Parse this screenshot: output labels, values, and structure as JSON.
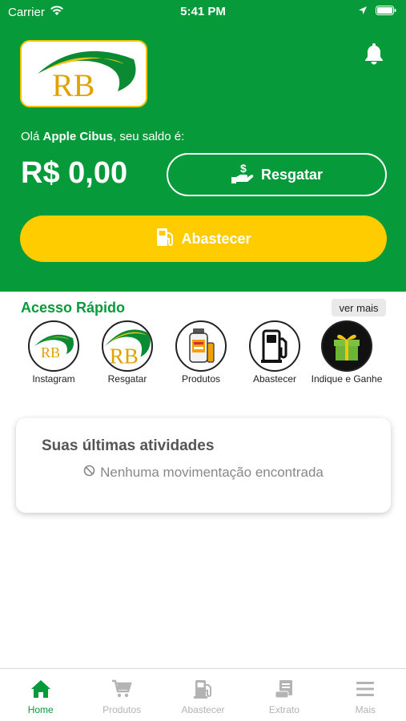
{
  "status_bar": {
    "carrier": "Carrier",
    "time": "5:41 PM"
  },
  "header": {
    "logo_text": "RB",
    "greeting_prefix": "Olá ",
    "user_name": "Apple Cibus",
    "greeting_suffix": ", seu saldo é:",
    "balance": "R$ 0,00",
    "resgatar_label": "Resgatar",
    "abastecer_label": "Abastecer"
  },
  "quick_access": {
    "title": "Acesso Rápido",
    "ver_mais": "ver mais",
    "items": [
      {
        "label": "Instagram",
        "icon": "rb-logo-icon"
      },
      {
        "label": "Resgatar",
        "icon": "rb-logo-icon"
      },
      {
        "label": "Produtos",
        "icon": "oil-bottle-icon"
      },
      {
        "label": "Abastecer",
        "icon": "fuel-pump-icon"
      },
      {
        "label": "Indique e Ganhe",
        "icon": "gift-icon"
      }
    ]
  },
  "activities": {
    "title": "Suas últimas atividades",
    "empty": "Nenhuma movimentação encontrada"
  },
  "tabbar": {
    "tabs": [
      {
        "label": "Home",
        "icon": "home-icon",
        "active": true
      },
      {
        "label": "Produtos",
        "icon": "cart-icon",
        "active": false
      },
      {
        "label": "Abastecer",
        "icon": "fuel-pump-icon",
        "active": false
      },
      {
        "label": "Extrato",
        "icon": "receipt-icon",
        "active": false
      },
      {
        "label": "Mais",
        "icon": "menu-icon",
        "active": false
      }
    ]
  },
  "colors": {
    "primary": "#079a3a",
    "accent": "#ffcc00"
  }
}
